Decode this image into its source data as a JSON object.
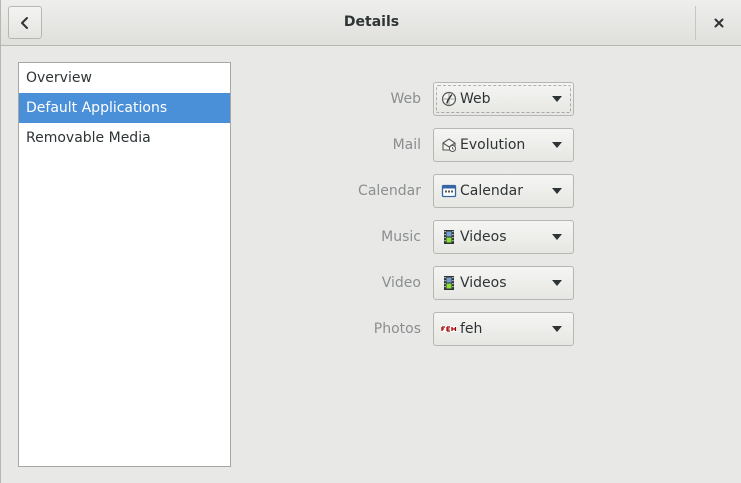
{
  "header": {
    "title": "Details"
  },
  "sidebar": {
    "items": [
      {
        "label": "Overview"
      },
      {
        "label": "Default Applications"
      },
      {
        "label": "Removable Media"
      }
    ],
    "selected": "Default Applications"
  },
  "defaults": [
    {
      "label": "Web",
      "value": "Web",
      "icon": "web-browser-icon"
    },
    {
      "label": "Mail",
      "value": "Evolution",
      "icon": "evolution-mail-icon"
    },
    {
      "label": "Calendar",
      "value": "Calendar",
      "icon": "calendar-icon"
    },
    {
      "label": "Music",
      "value": "Videos",
      "icon": "videos-film-icon"
    },
    {
      "label": "Video",
      "value": "Videos",
      "icon": "videos-film-icon"
    },
    {
      "label": "Photos",
      "value": "feh",
      "icon": "feh-icon"
    }
  ],
  "colors": {
    "accent": "#4a90d9",
    "label": "#8b8e8f",
    "background": "#e8e8e7"
  }
}
